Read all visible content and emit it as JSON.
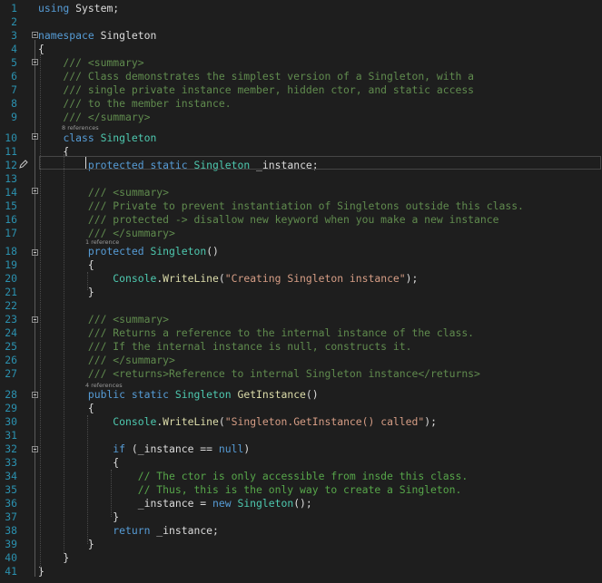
{
  "editor": {
    "language": "csharp",
    "current_line": 12,
    "lines": [
      {
        "n": "1",
        "segs": [
          [
            "kw",
            "using"
          ],
          [
            "pl",
            " System;"
          ]
        ]
      },
      {
        "n": "2",
        "segs": []
      },
      {
        "n": "3",
        "segs": [
          [
            "kw",
            "namespace"
          ],
          [
            "pl",
            " Singleton"
          ]
        ]
      },
      {
        "n": "4",
        "segs": [
          [
            "pl",
            "{"
          ]
        ]
      },
      {
        "n": "5",
        "segs": [
          [
            "cmt",
            "    /// <summary>"
          ]
        ]
      },
      {
        "n": "6",
        "segs": [
          [
            "cmt",
            "    /// Class demonstrates the simplest version of a Singleton, with a"
          ]
        ]
      },
      {
        "n": "7",
        "segs": [
          [
            "cmt",
            "    /// single private instance member, hidden ctor, and static access"
          ]
        ]
      },
      {
        "n": "8",
        "segs": [
          [
            "cmt",
            "    /// to the member instance."
          ]
        ]
      },
      {
        "n": "9",
        "segs": [
          [
            "cmt",
            "    /// </summary>"
          ]
        ]
      },
      {
        "n": "10",
        "segs": [
          [
            "pl",
            "    "
          ],
          [
            "kw",
            "class"
          ],
          [
            "pl",
            " "
          ],
          [
            "ty",
            "Singleton"
          ]
        ]
      },
      {
        "n": "11",
        "segs": [
          [
            "pl",
            "    {"
          ]
        ]
      },
      {
        "n": "12",
        "segs": [
          [
            "pl",
            "        "
          ],
          [
            "kw",
            "protected static"
          ],
          [
            "pl",
            " "
          ],
          [
            "ty",
            "Singleton"
          ],
          [
            "pl",
            " _instance;"
          ]
        ]
      },
      {
        "n": "13",
        "segs": []
      },
      {
        "n": "14",
        "segs": [
          [
            "cmt",
            "        /// <summary>"
          ]
        ]
      },
      {
        "n": "15",
        "segs": [
          [
            "cmt",
            "        /// Private to prevent instantiation of Singletons outside this class."
          ]
        ]
      },
      {
        "n": "16",
        "segs": [
          [
            "cmt",
            "        /// protected -> disallow new keyword when you make a new instance"
          ]
        ]
      },
      {
        "n": "17",
        "segs": [
          [
            "cmt",
            "        /// </summary>"
          ]
        ]
      },
      {
        "n": "18",
        "segs": [
          [
            "pl",
            "        "
          ],
          [
            "kw",
            "protected"
          ],
          [
            "pl",
            " "
          ],
          [
            "ty",
            "Singleton"
          ],
          [
            "pl",
            "()"
          ]
        ]
      },
      {
        "n": "19",
        "segs": [
          [
            "pl",
            "        {"
          ]
        ]
      },
      {
        "n": "20",
        "segs": [
          [
            "pl",
            "            "
          ],
          [
            "ty",
            "Console"
          ],
          [
            "pl",
            "."
          ],
          [
            "mt",
            "WriteLine"
          ],
          [
            "pl",
            "("
          ],
          [
            "st",
            "\"Creating Singleton instance\""
          ],
          [
            "pl",
            ");"
          ]
        ]
      },
      {
        "n": "21",
        "segs": [
          [
            "pl",
            "        }"
          ]
        ]
      },
      {
        "n": "22",
        "segs": []
      },
      {
        "n": "23",
        "segs": [
          [
            "cmt",
            "        /// <summary>"
          ]
        ]
      },
      {
        "n": "24",
        "segs": [
          [
            "cmt",
            "        /// Returns a reference to the internal instance of the class."
          ]
        ]
      },
      {
        "n": "25",
        "segs": [
          [
            "cmt",
            "        /// If the internal instance is null, constructs it."
          ]
        ]
      },
      {
        "n": "26",
        "segs": [
          [
            "cmt",
            "        /// </summary>"
          ]
        ]
      },
      {
        "n": "27",
        "segs": [
          [
            "cmt",
            "        /// <returns>Reference to internal Singleton instance</returns>"
          ]
        ]
      },
      {
        "n": "28",
        "segs": [
          [
            "pl",
            "        "
          ],
          [
            "kw",
            "public static"
          ],
          [
            "pl",
            " "
          ],
          [
            "ty",
            "Singleton"
          ],
          [
            "pl",
            " "
          ],
          [
            "mt",
            "GetInstance"
          ],
          [
            "pl",
            "()"
          ]
        ]
      },
      {
        "n": "29",
        "segs": [
          [
            "pl",
            "        {"
          ]
        ]
      },
      {
        "n": "30",
        "segs": [
          [
            "pl",
            "            "
          ],
          [
            "ty",
            "Console"
          ],
          [
            "pl",
            "."
          ],
          [
            "mt",
            "WriteLine"
          ],
          [
            "pl",
            "("
          ],
          [
            "st",
            "\"Singleton.GetInstance() called\""
          ],
          [
            "pl",
            ");"
          ]
        ]
      },
      {
        "n": "31",
        "segs": []
      },
      {
        "n": "32",
        "segs": [
          [
            "pl",
            "            "
          ],
          [
            "kw",
            "if"
          ],
          [
            "pl",
            " (_instance == "
          ],
          [
            "kw",
            "null"
          ],
          [
            "pl",
            ")"
          ]
        ]
      },
      {
        "n": "33",
        "segs": [
          [
            "pl",
            "            {"
          ]
        ]
      },
      {
        "n": "34",
        "segs": [
          [
            "cm",
            "                // The ctor is only accessible from insde this class."
          ]
        ]
      },
      {
        "n": "35",
        "segs": [
          [
            "cm",
            "                // Thus, this is the only way to create a Singleton."
          ]
        ]
      },
      {
        "n": "36",
        "segs": [
          [
            "pl",
            "                _instance = "
          ],
          [
            "kw",
            "new"
          ],
          [
            "pl",
            " "
          ],
          [
            "ty",
            "Singleton"
          ],
          [
            "pl",
            "();"
          ]
        ]
      },
      {
        "n": "37",
        "segs": [
          [
            "pl",
            "            }"
          ]
        ]
      },
      {
        "n": "38",
        "segs": [
          [
            "pl",
            "            "
          ],
          [
            "kw",
            "return"
          ],
          [
            "pl",
            " _instance;"
          ]
        ]
      },
      {
        "n": "39",
        "segs": [
          [
            "pl",
            "        }"
          ]
        ]
      },
      {
        "n": "40",
        "segs": [
          [
            "pl",
            "    }"
          ]
        ]
      },
      {
        "n": "41",
        "segs": [
          [
            "pl",
            "}"
          ]
        ]
      }
    ],
    "codelens": [
      {
        "text": "8 references",
        "before_line": 10
      },
      {
        "text": "1 reference",
        "before_line": 18
      },
      {
        "text": "4 references",
        "before_line": 28
      }
    ]
  }
}
